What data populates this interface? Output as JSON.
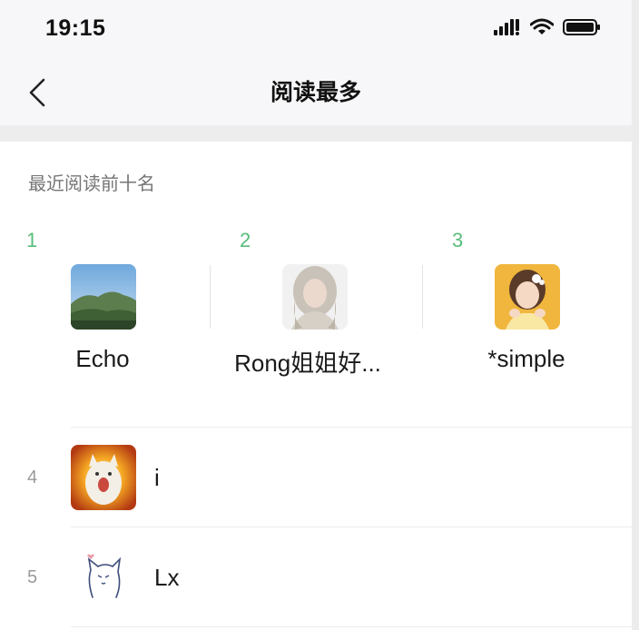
{
  "status_bar": {
    "time": "19:15"
  },
  "nav": {
    "title": "阅读最多"
  },
  "section": {
    "label": "最近阅读前十名"
  },
  "top_three": [
    {
      "rank": "1",
      "name": "Echo"
    },
    {
      "rank": "2",
      "name": "Rong姐姐好..."
    },
    {
      "rank": "3",
      "name": "*simple"
    }
  ],
  "list": [
    {
      "rank": "4",
      "name": "i"
    },
    {
      "rank": "5",
      "name": "Lx"
    }
  ],
  "colors": {
    "rank_accent": "#57bd7a",
    "nav_background": "#f7f7f9"
  }
}
